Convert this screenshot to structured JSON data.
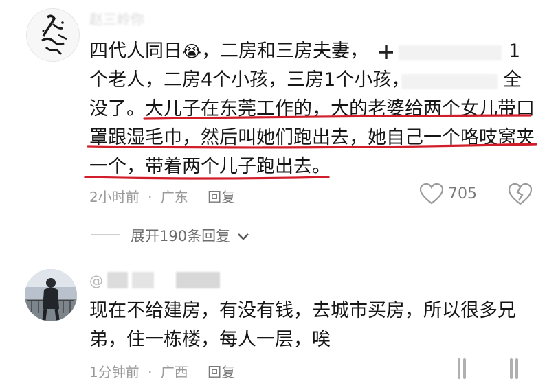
{
  "comment1": {
    "username": "赵三岭你",
    "text_line1_a": "四代人同日",
    "emoji": "😭",
    "text_line1_b": "，二房和三房夫妻，",
    "text_line1_c": "1",
    "text_line2_a": "个老人，二房4个小孩，三房1个小孩，",
    "text_line2_b": "全",
    "text_line3_a": "没了。",
    "text_line3_b": "大儿子在东莞工作的，大的老婆给两个女儿带口",
    "text_line4": "罩跟湿毛巾，然后叫她们跑出去，她自己一个咯吱窝夹",
    "text_line5": "一个，带着两个儿子跑出去。",
    "time": "2小时前",
    "location": "广东",
    "reply_label": "回复",
    "like_count": "705",
    "expand_label": "展开190条回复"
  },
  "comment2": {
    "username_prefix": "@",
    "text_line1": "现在不给建房，有没有钱，去城市买房，所以很多兄",
    "text_line2": "弟，住一栋楼，每人一层，唉",
    "time": "1分钟前",
    "location": "广西",
    "reply_label": "回复"
  },
  "colors": {
    "highlight_underline": "#d21e2b",
    "meta_text": "#9a9a9a"
  },
  "icons": [
    "heart-icon",
    "broken-heart-icon",
    "chevron-down-icon",
    "plus-icon",
    "like-icon",
    "dislike-icon"
  ]
}
